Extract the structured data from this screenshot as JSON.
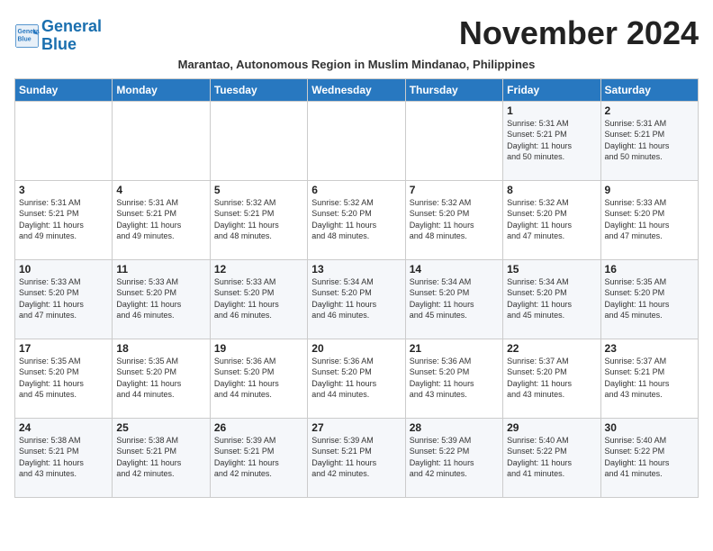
{
  "logo": {
    "line1": "General",
    "line2": "Blue"
  },
  "title": "November 2024",
  "subtitle": "Marantao, Autonomous Region in Muslim Mindanao, Philippines",
  "days_of_week": [
    "Sunday",
    "Monday",
    "Tuesday",
    "Wednesday",
    "Thursday",
    "Friday",
    "Saturday"
  ],
  "weeks": [
    [
      {
        "day": "",
        "info": ""
      },
      {
        "day": "",
        "info": ""
      },
      {
        "day": "",
        "info": ""
      },
      {
        "day": "",
        "info": ""
      },
      {
        "day": "",
        "info": ""
      },
      {
        "day": "1",
        "info": "Sunrise: 5:31 AM\nSunset: 5:21 PM\nDaylight: 11 hours\nand 50 minutes."
      },
      {
        "day": "2",
        "info": "Sunrise: 5:31 AM\nSunset: 5:21 PM\nDaylight: 11 hours\nand 50 minutes."
      }
    ],
    [
      {
        "day": "3",
        "info": "Sunrise: 5:31 AM\nSunset: 5:21 PM\nDaylight: 11 hours\nand 49 minutes."
      },
      {
        "day": "4",
        "info": "Sunrise: 5:31 AM\nSunset: 5:21 PM\nDaylight: 11 hours\nand 49 minutes."
      },
      {
        "day": "5",
        "info": "Sunrise: 5:32 AM\nSunset: 5:21 PM\nDaylight: 11 hours\nand 48 minutes."
      },
      {
        "day": "6",
        "info": "Sunrise: 5:32 AM\nSunset: 5:20 PM\nDaylight: 11 hours\nand 48 minutes."
      },
      {
        "day": "7",
        "info": "Sunrise: 5:32 AM\nSunset: 5:20 PM\nDaylight: 11 hours\nand 48 minutes."
      },
      {
        "day": "8",
        "info": "Sunrise: 5:32 AM\nSunset: 5:20 PM\nDaylight: 11 hours\nand 47 minutes."
      },
      {
        "day": "9",
        "info": "Sunrise: 5:33 AM\nSunset: 5:20 PM\nDaylight: 11 hours\nand 47 minutes."
      }
    ],
    [
      {
        "day": "10",
        "info": "Sunrise: 5:33 AM\nSunset: 5:20 PM\nDaylight: 11 hours\nand 47 minutes."
      },
      {
        "day": "11",
        "info": "Sunrise: 5:33 AM\nSunset: 5:20 PM\nDaylight: 11 hours\nand 46 minutes."
      },
      {
        "day": "12",
        "info": "Sunrise: 5:33 AM\nSunset: 5:20 PM\nDaylight: 11 hours\nand 46 minutes."
      },
      {
        "day": "13",
        "info": "Sunrise: 5:34 AM\nSunset: 5:20 PM\nDaylight: 11 hours\nand 46 minutes."
      },
      {
        "day": "14",
        "info": "Sunrise: 5:34 AM\nSunset: 5:20 PM\nDaylight: 11 hours\nand 45 minutes."
      },
      {
        "day": "15",
        "info": "Sunrise: 5:34 AM\nSunset: 5:20 PM\nDaylight: 11 hours\nand 45 minutes."
      },
      {
        "day": "16",
        "info": "Sunrise: 5:35 AM\nSunset: 5:20 PM\nDaylight: 11 hours\nand 45 minutes."
      }
    ],
    [
      {
        "day": "17",
        "info": "Sunrise: 5:35 AM\nSunset: 5:20 PM\nDaylight: 11 hours\nand 45 minutes."
      },
      {
        "day": "18",
        "info": "Sunrise: 5:35 AM\nSunset: 5:20 PM\nDaylight: 11 hours\nand 44 minutes."
      },
      {
        "day": "19",
        "info": "Sunrise: 5:36 AM\nSunset: 5:20 PM\nDaylight: 11 hours\nand 44 minutes."
      },
      {
        "day": "20",
        "info": "Sunrise: 5:36 AM\nSunset: 5:20 PM\nDaylight: 11 hours\nand 44 minutes."
      },
      {
        "day": "21",
        "info": "Sunrise: 5:36 AM\nSunset: 5:20 PM\nDaylight: 11 hours\nand 43 minutes."
      },
      {
        "day": "22",
        "info": "Sunrise: 5:37 AM\nSunset: 5:20 PM\nDaylight: 11 hours\nand 43 minutes."
      },
      {
        "day": "23",
        "info": "Sunrise: 5:37 AM\nSunset: 5:21 PM\nDaylight: 11 hours\nand 43 minutes."
      }
    ],
    [
      {
        "day": "24",
        "info": "Sunrise: 5:38 AM\nSunset: 5:21 PM\nDaylight: 11 hours\nand 43 minutes."
      },
      {
        "day": "25",
        "info": "Sunrise: 5:38 AM\nSunset: 5:21 PM\nDaylight: 11 hours\nand 42 minutes."
      },
      {
        "day": "26",
        "info": "Sunrise: 5:39 AM\nSunset: 5:21 PM\nDaylight: 11 hours\nand 42 minutes."
      },
      {
        "day": "27",
        "info": "Sunrise: 5:39 AM\nSunset: 5:21 PM\nDaylight: 11 hours\nand 42 minutes."
      },
      {
        "day": "28",
        "info": "Sunrise: 5:39 AM\nSunset: 5:22 PM\nDaylight: 11 hours\nand 42 minutes."
      },
      {
        "day": "29",
        "info": "Sunrise: 5:40 AM\nSunset: 5:22 PM\nDaylight: 11 hours\nand 41 minutes."
      },
      {
        "day": "30",
        "info": "Sunrise: 5:40 AM\nSunset: 5:22 PM\nDaylight: 11 hours\nand 41 minutes."
      }
    ]
  ]
}
